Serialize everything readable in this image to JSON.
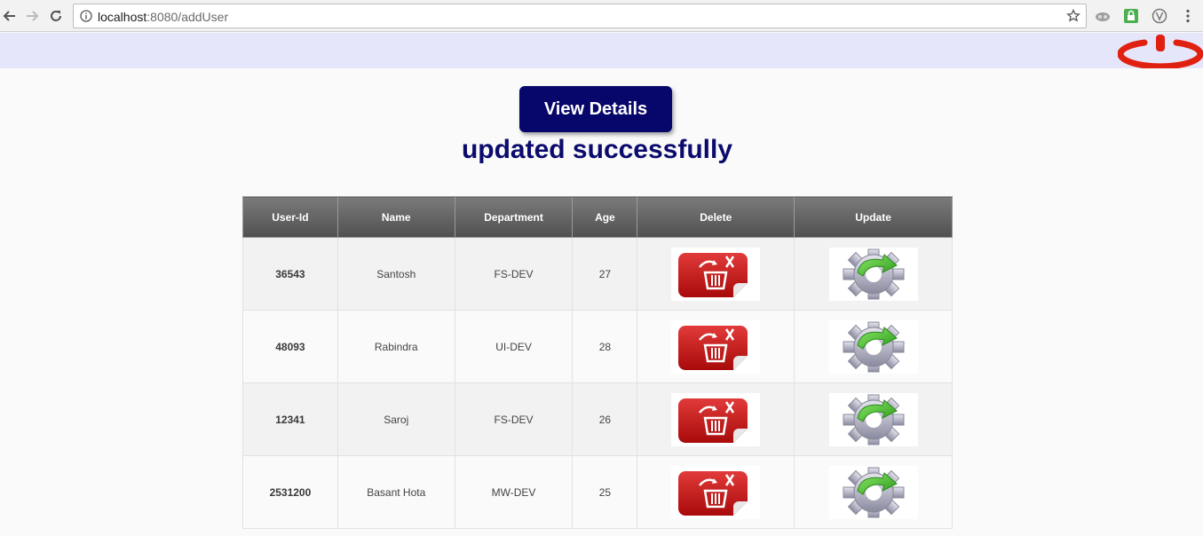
{
  "browser": {
    "url_host": "localhost",
    "url_path": ":8080/addUser"
  },
  "main": {
    "view_button_label": "View Details",
    "status_message": "updated successfully"
  },
  "table": {
    "headers": [
      "User-Id",
      "Name",
      "Department",
      "Age",
      "Delete",
      "Update"
    ],
    "rows": [
      {
        "user_id": "36543",
        "name": "Santosh",
        "department": "FS-DEV",
        "age": "27"
      },
      {
        "user_id": "48093",
        "name": "Rabindra",
        "department": "UI-DEV",
        "age": "28"
      },
      {
        "user_id": "12341",
        "name": "Saroj",
        "department": "FS-DEV",
        "age": "26"
      },
      {
        "user_id": "2531200",
        "name": "Basant Hota",
        "department": "MW-DEV",
        "age": "25"
      }
    ]
  },
  "icons": {
    "power": "power-icon",
    "delete": "trash-delete-icon",
    "update": "gear-update-icon"
  },
  "colors": {
    "header_band": "#e6e6fa",
    "button": "#07076b",
    "message": "#0b0b6e",
    "power": "#e02010"
  }
}
